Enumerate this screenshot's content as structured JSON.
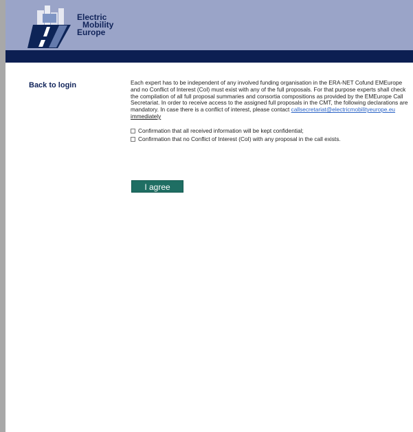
{
  "brand": {
    "logo_lines": [
      "Electric",
      "Mobility",
      "Europe"
    ],
    "colors": {
      "header": "#9aa4c8",
      "header_band": "#0c1f52",
      "accent": "#1f6e63",
      "link": "#2a63c6"
    }
  },
  "nav": {
    "back_label": "Back to login"
  },
  "main": {
    "intro_text": "Each expert has to be independent of any involved funding organisation in the ERA-NET Cofund EMEurope and no Conflict of Interest (CoI) must exist with any of the full proposals. For that purpose experts shall check the compilation of all full proposal summaries and consortia compositions as provided by the EMEurope Call Secretariat. In order to receive access to the assigned full proposals in the CMT, the following declarations are mandatory. In case there is a conflict of interest, please contact ",
    "email": "callsecretariat@electricmobilityeurope.eu",
    "immediately": "immediately",
    "checkbox_items": [
      "Confirmation that all received information will be kept confidential;",
      "Confirmation that no Conflict of Interest (CoI) with any proposal in the call exists."
    ],
    "agree_label": "I agree"
  },
  "icons": {
    "logo": "electric-mobility-europe-logo",
    "checkbox": "checkbox-unchecked-icon"
  }
}
